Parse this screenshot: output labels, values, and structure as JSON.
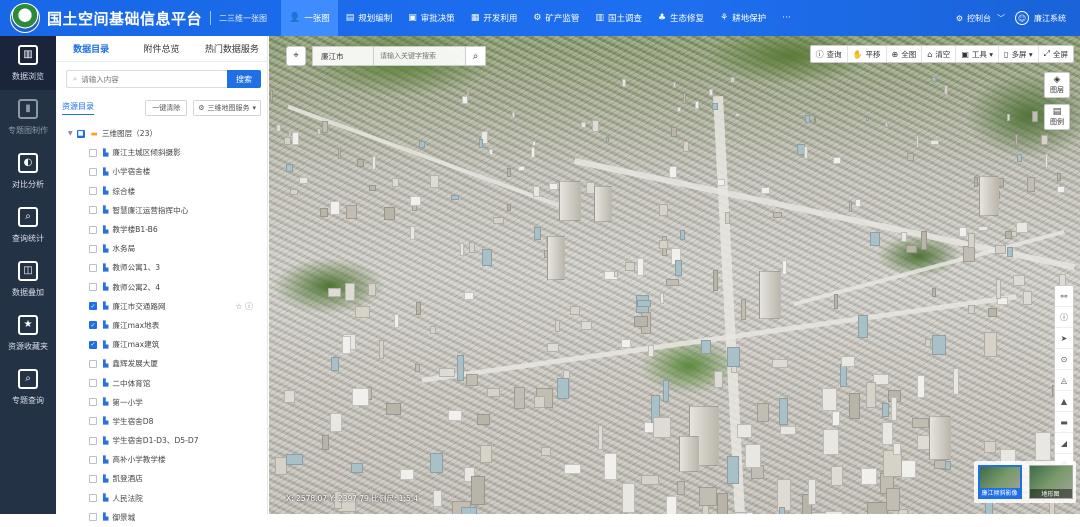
{
  "header": {
    "app_title": "国土空间基础信息平台",
    "subtitle": "二三维一张图",
    "nav": [
      {
        "icon": "👤",
        "label": "一张图",
        "active": true
      },
      {
        "icon": "▤",
        "label": "规划编制"
      },
      {
        "icon": "▣",
        "label": "审批决策"
      },
      {
        "icon": "▦",
        "label": "开发利用"
      },
      {
        "icon": "⚙",
        "label": "矿产监管"
      },
      {
        "icon": "▥",
        "label": "国土调查"
      },
      {
        "icon": "♣",
        "label": "生态修复"
      },
      {
        "icon": "⚘",
        "label": "耕地保护"
      },
      {
        "icon": "···",
        "label": ""
      }
    ],
    "control_label": "控制台",
    "user_label": "廉江系统"
  },
  "sidebar": {
    "items": [
      {
        "label": "数据浏览",
        "icon": "chart-board-icon",
        "glyph": "▥",
        "active": true
      },
      {
        "label": "专题图制作",
        "icon": "map-book-icon",
        "glyph": "▮"
      },
      {
        "label": "对比分析",
        "icon": "pie-icon",
        "glyph": "◐"
      },
      {
        "label": "查询统计",
        "icon": "magnifier-icon",
        "glyph": "⌕"
      },
      {
        "label": "数据叠加",
        "icon": "layers-stack-icon",
        "glyph": "◫"
      },
      {
        "label": "资源收藏夹",
        "icon": "star-folder-icon",
        "glyph": "★"
      },
      {
        "label": "专题查询",
        "icon": "search-doc-icon",
        "glyph": "⌕"
      }
    ]
  },
  "panel": {
    "tabs": [
      "数据目录",
      "附件总览",
      "热门数据服务"
    ],
    "search_placeholder": "请输入内容",
    "search_button": "搜索",
    "resource_label": "资源目录",
    "clear_button": "一键清除",
    "mode_select": "三维地图服务",
    "root": {
      "label": "三维图层（23）"
    },
    "items": [
      {
        "label": "廉江主城区倾斜摄影",
        "checked": false
      },
      {
        "label": "小学宿舍楼",
        "checked": false
      },
      {
        "label": "综合楼",
        "checked": false
      },
      {
        "label": "智慧廉江运营指挥中心",
        "checked": false
      },
      {
        "label": "教学楼B1-B6",
        "checked": false
      },
      {
        "label": "水务局",
        "checked": false
      },
      {
        "label": "教师公寓1、3",
        "checked": false
      },
      {
        "label": "教师公寓2、4",
        "checked": false
      },
      {
        "label": "廉江市交通路网",
        "checked": true,
        "icons": "☆ ⓘ"
      },
      {
        "label": "廉江max地表",
        "checked": true
      },
      {
        "label": "廉江max建筑",
        "checked": true
      },
      {
        "label": "鑫辉发展大厦",
        "checked": false
      },
      {
        "label": "二中体育馆",
        "checked": false
      },
      {
        "label": "第一小学",
        "checked": false
      },
      {
        "label": "学生宿舍D8",
        "checked": false
      },
      {
        "label": "学生宿舍D1-D3、D5-D7",
        "checked": false
      },
      {
        "label": "高补小学教学楼",
        "checked": false
      },
      {
        "label": "凯登酒店",
        "checked": false
      },
      {
        "label": "人民法院",
        "checked": false
      },
      {
        "label": "御景城",
        "checked": false
      }
    ]
  },
  "map": {
    "city_select": "廉江市",
    "keyword_placeholder": "请输入关键字搜索",
    "tools": [
      {
        "icon": "ⓘ",
        "label": "查询"
      },
      {
        "icon": "✋",
        "label": "平移"
      },
      {
        "icon": "⊕",
        "label": "全图"
      },
      {
        "icon": "⌂",
        "label": "清空"
      },
      {
        "icon": "▣",
        "label": "工具 ▾"
      },
      {
        "icon": "▯",
        "label": "多屏 ▾"
      },
      {
        "icon": "⤢",
        "label": "全屏"
      }
    ],
    "layer_buttons": [
      {
        "icon": "◈",
        "label": "图层"
      },
      {
        "icon": "▤",
        "label": "图例"
      }
    ],
    "side_tools": [
      "⚯",
      "ⓘ",
      "➤",
      "⊙",
      "◬",
      "▲",
      "▬",
      "◢",
      "⚙"
    ],
    "coords": "X: 2578.07   Y: 2397.79   比例尺: 1:5.4",
    "basemaps": [
      {
        "label": "廉江倾斜影像",
        "active": true
      },
      {
        "label": "地形图",
        "active": false
      }
    ]
  },
  "colors": {
    "brand": "#1e6ff0",
    "sidebar": "#243246",
    "accent": "#1f6fe5"
  }
}
